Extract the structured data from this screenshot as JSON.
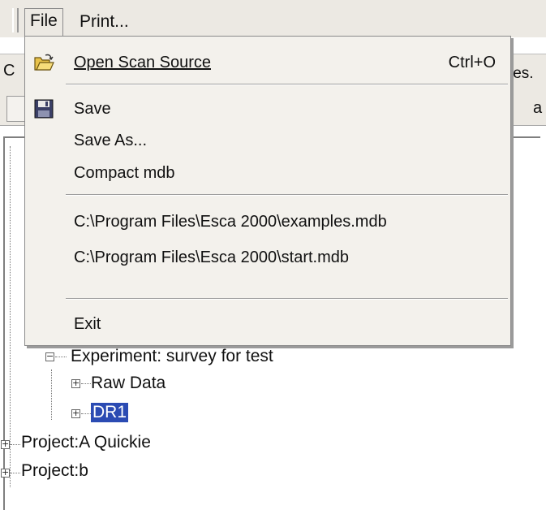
{
  "menubar": {
    "file_label": "File",
    "print_label": "Print..."
  },
  "background": {
    "c_text": "C",
    "files_text": "les.",
    "a_text": "a"
  },
  "file_menu": {
    "open_scan_label": "Open Scan Source",
    "open_scan_shortcut": "Ctrl+O",
    "save_label": "Save",
    "save_as_label": "Save As...",
    "compact_label": "Compact mdb",
    "recent_1": "C:\\Program Files\\Esca 2000\\examples.mdb",
    "recent_2": "C:\\Program Files\\Esca 2000\\start.mdb",
    "exit_label": "Exit"
  },
  "tree": {
    "experiment": "Experiment: survey for test",
    "raw_data": "Raw Data",
    "dr1": "DR1",
    "project_a": "Project:A Quickie",
    "project_b": "Project:b"
  },
  "icons": {
    "open_folder": "open-folder-icon",
    "save_disk": "floppy-disk-icon"
  },
  "colors": {
    "selection": "#2b4bb3",
    "menu_bg": "#f3f1ec"
  }
}
